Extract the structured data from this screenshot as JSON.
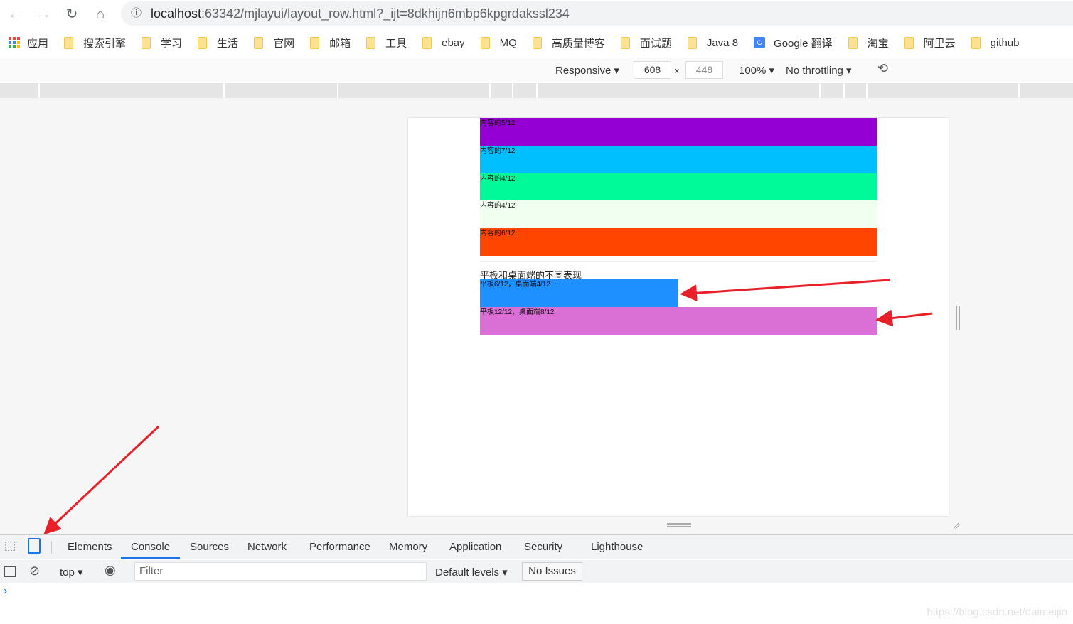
{
  "browser": {
    "url_host": "localhost",
    "url_rest": ":63342/mjlayui/layout_row.html?_ijt=8dkhijn6mbp6kpgrdakssl234"
  },
  "bookmarks": [
    {
      "label": "应用",
      "icon": "apps-icon"
    },
    {
      "label": "搜索引擎"
    },
    {
      "label": "学习"
    },
    {
      "label": "生活"
    },
    {
      "label": "官网"
    },
    {
      "label": "邮箱"
    },
    {
      "label": "工具"
    },
    {
      "label": "ebay"
    },
    {
      "label": "MQ"
    },
    {
      "label": "高质量博客"
    },
    {
      "label": "面试题"
    },
    {
      "label": "Java 8"
    },
    {
      "label": "Google 翻译",
      "icon": "google-translate-icon"
    },
    {
      "label": "淘宝"
    },
    {
      "label": "阿里云"
    },
    {
      "label": "github"
    }
  ],
  "device_toolbar": {
    "device": "Responsive",
    "width": "608",
    "height": "448",
    "zoom": "100%",
    "throttling": "No throttling",
    "x": "×"
  },
  "page": {
    "rows": [
      {
        "label": "内容的5/12",
        "color": "#9400d3"
      },
      {
        "label": "内容的7/12",
        "color": "#00bfff"
      },
      {
        "label": "内容的4/12",
        "color": "#00fa9a"
      },
      {
        "label": "内容的4/12",
        "color": "#f0fff0"
      },
      {
        "label": "内容的6/12",
        "color": "#ff4500"
      }
    ],
    "heading": "平板和桌面端的不同表现",
    "responsive_rows": [
      {
        "label": "平板6/12，桌面端4/12",
        "color": "#1e90ff",
        "span": 6
      },
      {
        "label": "平板12/12，桌面端8/12",
        "color": "#da70d6",
        "span": 12
      }
    ]
  },
  "devtools": {
    "tabs": [
      "Elements",
      "Console",
      "Sources",
      "Network",
      "Performance",
      "Memory",
      "Application",
      "Security",
      "Lighthouse"
    ],
    "active_tab": "Console",
    "context": "top",
    "filter_placeholder": "Filter",
    "levels": "Default levels",
    "issues": "No Issues",
    "prompt": "›"
  },
  "annotation_color": "#e8202a",
  "watermark": "https://blog.csdn.net/daimeijin"
}
